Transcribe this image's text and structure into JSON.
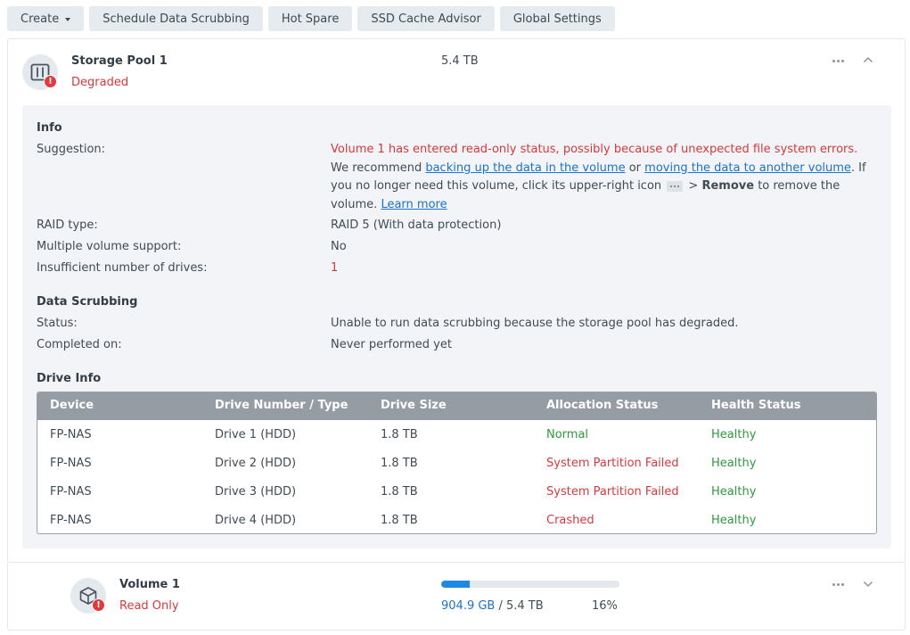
{
  "toolbar": {
    "create_label": "Create",
    "scrub_label": "Schedule Data Scrubbing",
    "hot_spare_label": "Hot Spare",
    "ssd_cache_label": "SSD Cache Advisor",
    "global_settings_label": "Global Settings"
  },
  "pool": {
    "name": "Storage Pool 1",
    "status": "Degraded",
    "capacity": "5.4 TB",
    "info": {
      "heading": "Info",
      "suggestion_label": "Suggestion:",
      "suggestion_error": "Volume 1 has entered read-only status, possibly because of unexpected file system errors.",
      "suggestion_p1": "We recommend ",
      "suggestion_link1": "backing up the data in the volume",
      "suggestion_p2": " or ",
      "suggestion_link2": "moving the data to another volume",
      "suggestion_p3": ". If you no longer need this volume, click its upper-right icon ",
      "suggestion_p4": " > ",
      "suggestion_bold": "Remove",
      "suggestion_p5": " to remove the volume. ",
      "suggestion_learn_more": "Learn more",
      "raid_label": "RAID type:",
      "raid_value": "RAID 5 (With data protection)",
      "multi_label": "Multiple volume support:",
      "multi_value": "No",
      "insuff_label": "Insufficient number of drives:",
      "insuff_value": "1"
    },
    "scrubbing": {
      "heading": "Data Scrubbing",
      "status_label": "Status:",
      "status_value": "Unable to run data scrubbing because the storage pool has degraded.",
      "completed_label": "Completed on:",
      "completed_value": "Never performed yet"
    },
    "drive_info": {
      "heading": "Drive Info",
      "columns": [
        "Device",
        "Drive Number / Type",
        "Drive Size",
        "Allocation Status",
        "Health Status"
      ],
      "rows": [
        {
          "device": "FP-NAS",
          "drive": "Drive 1 (HDD)",
          "size": "1.8 TB",
          "allocation": "Normal",
          "health": "Healthy"
        },
        {
          "device": "FP-NAS",
          "drive": "Drive 2 (HDD)",
          "size": "1.8 TB",
          "allocation": "System Partition Failed",
          "health": "Healthy"
        },
        {
          "device": "FP-NAS",
          "drive": "Drive 3 (HDD)",
          "size": "1.8 TB",
          "allocation": "System Partition Failed",
          "health": "Healthy"
        },
        {
          "device": "FP-NAS",
          "drive": "Drive 4 (HDD)",
          "size": "1.8 TB",
          "allocation": "Crashed",
          "health": "Healthy"
        }
      ]
    }
  },
  "volume": {
    "name": "Volume 1",
    "status": "Read Only",
    "used": "904.9 GB",
    "separator": " / ",
    "total": "5.4 TB",
    "percent": "16%",
    "usage_fraction": 0.16
  },
  "colors": {
    "error_red": "#d6393d",
    "healthy_green": "#2e9a3d",
    "link_blue": "#1a73c8",
    "usage_bar": "#1e88e5"
  },
  "icons": {
    "pool": "storage-pool-icon",
    "volume": "volume-cube-icon",
    "warning": "warning-badge-icon"
  }
}
